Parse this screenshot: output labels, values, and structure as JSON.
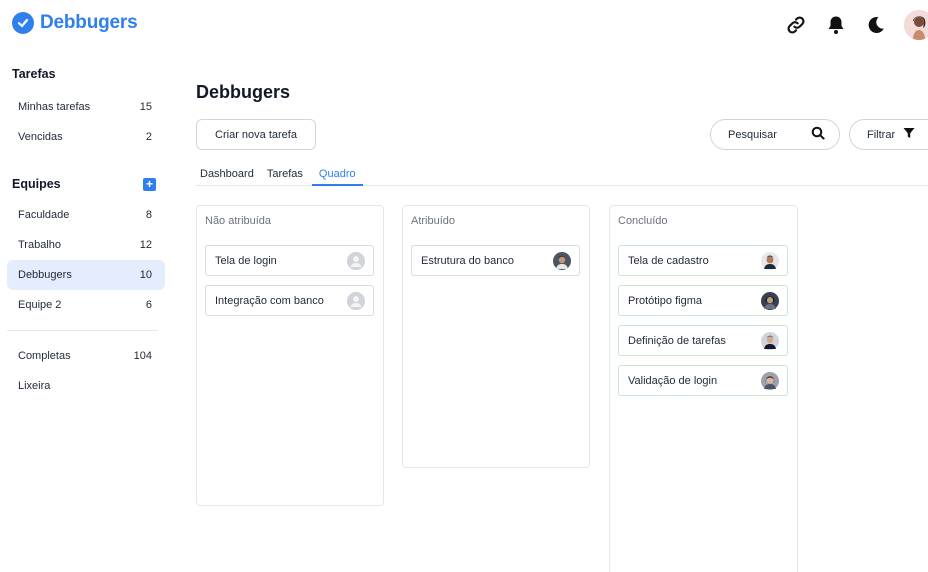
{
  "app": {
    "name": "Debbugers",
    "brand_color": "#2f80ed"
  },
  "topbar": {
    "icons": [
      "link-icon",
      "bell-icon",
      "moon-icon",
      "user-avatar"
    ]
  },
  "sidebar": {
    "tarefas_heading": "Tarefas",
    "tarefas_items": [
      {
        "label": "Minhas tarefas",
        "count": "15"
      },
      {
        "label": "Vencidas",
        "count": "2"
      }
    ],
    "equipes_heading": "Equipes",
    "equipes_items": [
      {
        "label": "Faculdade",
        "count": "8"
      },
      {
        "label": "Trabalho",
        "count": "12"
      },
      {
        "label": "Debbugers",
        "count": "10",
        "active": true
      },
      {
        "label": "Equipe 2",
        "count": "6"
      }
    ],
    "bottom_items": [
      {
        "label": "Completas",
        "count": "104"
      },
      {
        "label": "Lixeira",
        "count": ""
      }
    ]
  },
  "main": {
    "title": "Debbugers",
    "create_button": "Criar nova tarefa",
    "search_label": "Pesquisar",
    "filter_label": "Filtrar",
    "tabs": [
      {
        "label": "Dashboard"
      },
      {
        "label": "Tarefas"
      },
      {
        "label": "Quadro",
        "active": true
      }
    ],
    "columns": [
      {
        "title": "Não atribuída",
        "cards": [
          {
            "label": "Tela de login",
            "avatar": "default"
          },
          {
            "label": "Integração com banco",
            "avatar": "default"
          }
        ]
      },
      {
        "title": "Atribuído",
        "cards": [
          {
            "label": "Estrutura do banco",
            "avatar": "photo"
          }
        ]
      },
      {
        "title": "Concluído",
        "cards": [
          {
            "label": "Tela de cadastro",
            "avatar": "photo"
          },
          {
            "label": "Protótipo figma",
            "avatar": "photo"
          },
          {
            "label": "Definição de tarefas",
            "avatar": "photo"
          },
          {
            "label": "Validação de login",
            "avatar": "photo"
          }
        ]
      }
    ]
  }
}
